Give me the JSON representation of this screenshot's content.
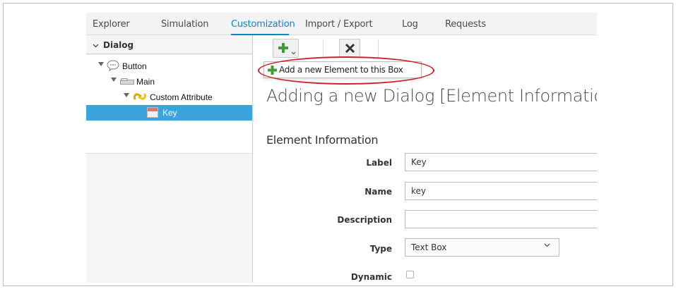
{
  "nav": {
    "tabs": [
      {
        "label": "Explorer"
      },
      {
        "label": "Simulation"
      },
      {
        "label": "Customization"
      },
      {
        "label": "Import / Export"
      },
      {
        "label": "Log"
      },
      {
        "label": "Requests"
      }
    ],
    "active_tab": "Customization"
  },
  "sidebar": {
    "header": "Dialog",
    "tree": [
      {
        "label": "Button",
        "icon": "speech-bubble-icon",
        "level": 0,
        "expanded": true
      },
      {
        "label": "Main",
        "icon": "tab-icon",
        "level": 1,
        "expanded": true
      },
      {
        "label": "Custom Attribute",
        "icon": "link-icon",
        "level": 2,
        "expanded": true
      },
      {
        "label": "Key",
        "icon": "textbox-icon",
        "level": 3,
        "selected": true
      }
    ]
  },
  "toolbar": {
    "add_icon": "plus-icon",
    "delete_icon": "x-icon",
    "dropdown_item": "Add a new Element to this Box"
  },
  "main": {
    "title": "Adding a new Dialog [Element Information]",
    "section": "Element Information",
    "fields": {
      "label": {
        "label": "Label",
        "value": "Key"
      },
      "name": {
        "label": "Name",
        "value": "key"
      },
      "description": {
        "label": "Description",
        "value": ""
      },
      "type": {
        "label": "Type",
        "value": "Text Box"
      },
      "dynamic": {
        "label": "Dynamic",
        "checked": false
      }
    }
  },
  "colors": {
    "accent": "#0088ce",
    "selected_row": "#39a5dc",
    "add_green": "#3f9c35",
    "callout_red": "#d0202a"
  }
}
